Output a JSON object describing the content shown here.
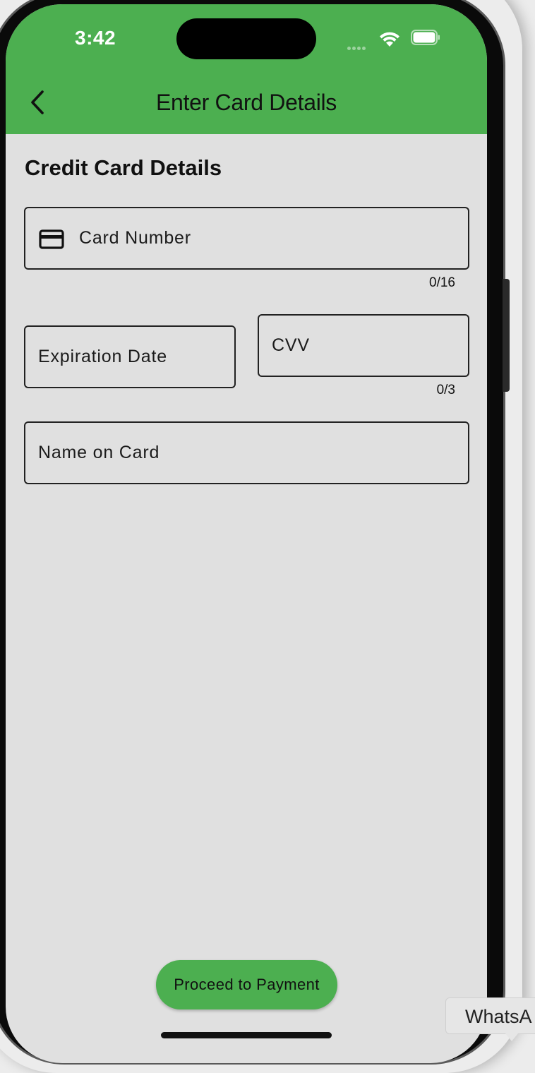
{
  "status_bar": {
    "time": "3:42"
  },
  "app_bar": {
    "title": "Enter Card Details",
    "back_icon": "chevron-left-icon",
    "background_color": "#4caf50"
  },
  "form": {
    "section_title": "Credit Card Details",
    "card_number": {
      "placeholder": "Card Number",
      "value": "",
      "counter": "0/16",
      "icon": "credit-card-icon"
    },
    "expiration_date": {
      "placeholder": "Expiration Date",
      "value": ""
    },
    "cvv": {
      "placeholder": "CVV",
      "value": "",
      "counter": "0/3"
    },
    "name_on_card": {
      "placeholder": "Name on Card",
      "value": ""
    }
  },
  "actions": {
    "proceed_label": "Proceed to Payment"
  },
  "dock_tooltip": {
    "text": "WhatsA"
  }
}
